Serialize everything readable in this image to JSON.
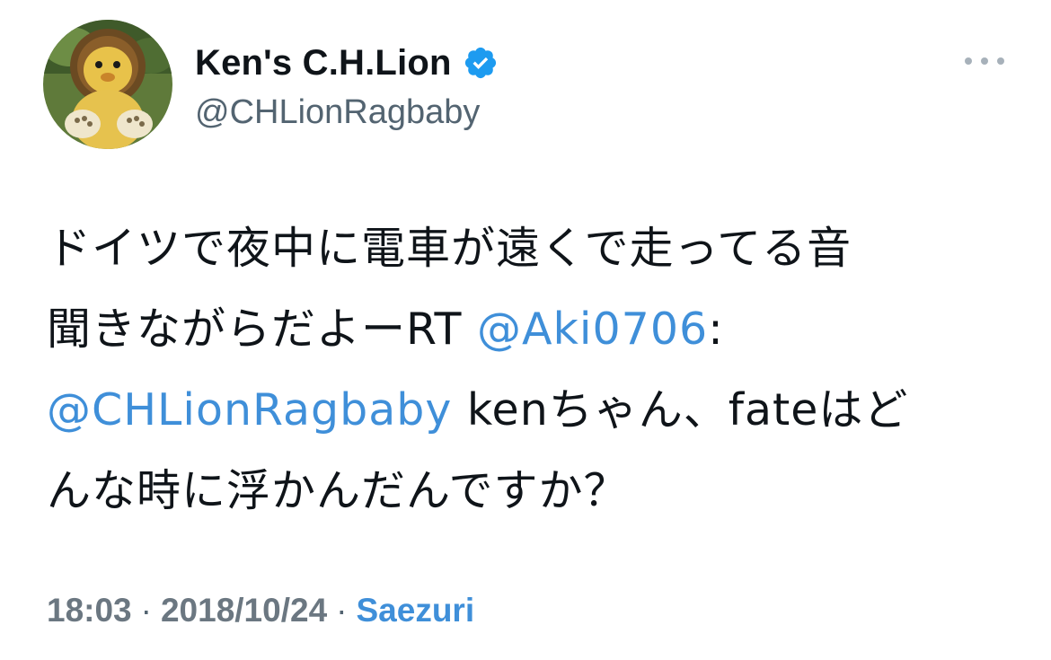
{
  "author": {
    "display_name": "Ken's C.H.Lion",
    "handle": "@CHLionRagbaby",
    "verified": true
  },
  "tweet": {
    "line1": "ドイツで夜中に電車が遠くで走ってる音",
    "line2_prefix": "聞きながらだよーRT ",
    "mention_1": "@Aki0706",
    "line2_suffix": ":",
    "mention_2": "@CHLionRagbaby",
    "line3_suffix": " kenちゃん、fateはど",
    "line4": "んな時に浮かんだんですか？"
  },
  "meta": {
    "time": "18:03",
    "separator": "·",
    "date": "2018/10/24",
    "source": "Saezuri"
  },
  "colors": {
    "link": "#3f8fd9",
    "verified": "#1d9bf0",
    "secondary_text": "#536471"
  },
  "icons": {
    "verified": "verified-badge-icon",
    "more": "more-dots-icon"
  }
}
